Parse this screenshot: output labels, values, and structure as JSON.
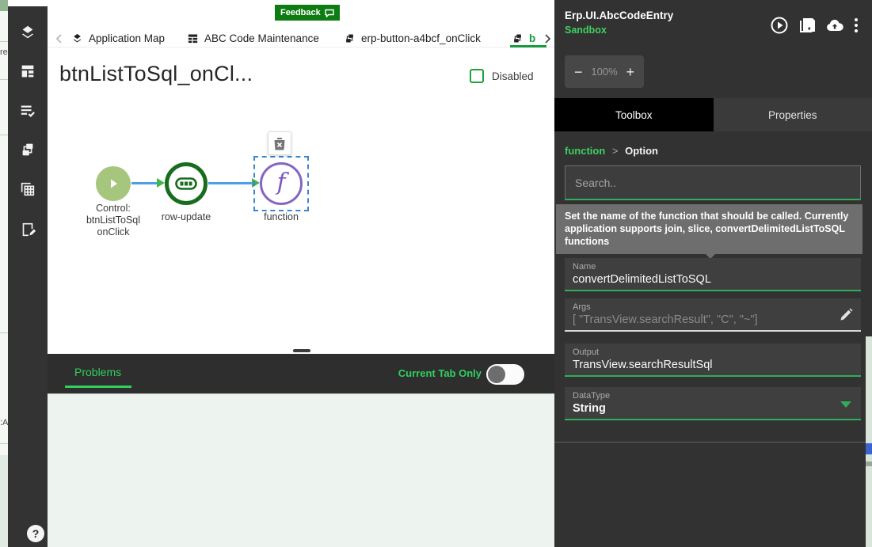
{
  "window": {
    "app_title": "Erp.UI.AbcCodeEntry",
    "environment": "Sandbox"
  },
  "feedback_badge": {
    "label": "Feedback"
  },
  "edge_fragments": {
    "top": "re",
    "bottom": ":A"
  },
  "left_rail": {
    "icons": [
      "layers-icon",
      "page-layout-icon",
      "list-check-icon",
      "flow-icon",
      "grid-copy-icon",
      "doc-edit-icon"
    ],
    "help_label": "?"
  },
  "tab_bar": {
    "tabs": [
      {
        "label": "Application Map",
        "icon": "layers-icon"
      },
      {
        "label": "ABC Code Maintenance",
        "icon": "table-icon"
      },
      {
        "label": "erp-button-a4bcf_onClick",
        "icon": "flow-icon"
      },
      {
        "label": "b",
        "icon": "flow-icon",
        "active": true
      }
    ]
  },
  "canvas": {
    "title": "btnListToSql_onCl...",
    "disabled_label": "Disabled",
    "flow": {
      "control_node": {
        "line1": "Control:",
        "line2": "btnListToSql",
        "line3": "onClick"
      },
      "row_update_node": {
        "label": "row-update"
      },
      "function_node": {
        "label": "function",
        "glyph": "f"
      }
    }
  },
  "problems_bar": {
    "tab_label": "Problems",
    "toggle_label": "Current Tab Only",
    "toggle_on": false
  },
  "panel": {
    "zoom": {
      "minus": "−",
      "level": "100%",
      "plus": "+"
    },
    "tabs": {
      "toolbox": "Toolbox",
      "properties": "Properties"
    },
    "breadcrumb": {
      "parent": "function",
      "separator": ">",
      "current": "Option"
    },
    "search_placeholder": "Search..",
    "tooltip": "Set the name of the function that should be called. Currently application supports join, slice, convertDelimitedListToSQL functions",
    "fields": {
      "name": {
        "label": "Name",
        "value": "convertDelimitedListToSQL"
      },
      "args": {
        "label": "Args",
        "value": "[ \"TransView.searchResult\", \"C\", \"~\"]"
      },
      "output": {
        "label": "Output",
        "value": "TransView.searchResultSql"
      },
      "datatype": {
        "label": "DataType",
        "value": "String"
      }
    }
  },
  "colors": {
    "green_accent": "#2fd05e",
    "green_underline": "#2fae57",
    "feedback_green": "#0d7c12",
    "panel_bg": "#323232",
    "node_green_ring": "#176d1d",
    "node_play_fill": "#a6c67d",
    "node_purple_ring": "#8465c0",
    "arrow_blue": "#4a9fe8",
    "arrowhead_green": "#46b44c",
    "selection_blue": "#3a86cf"
  }
}
